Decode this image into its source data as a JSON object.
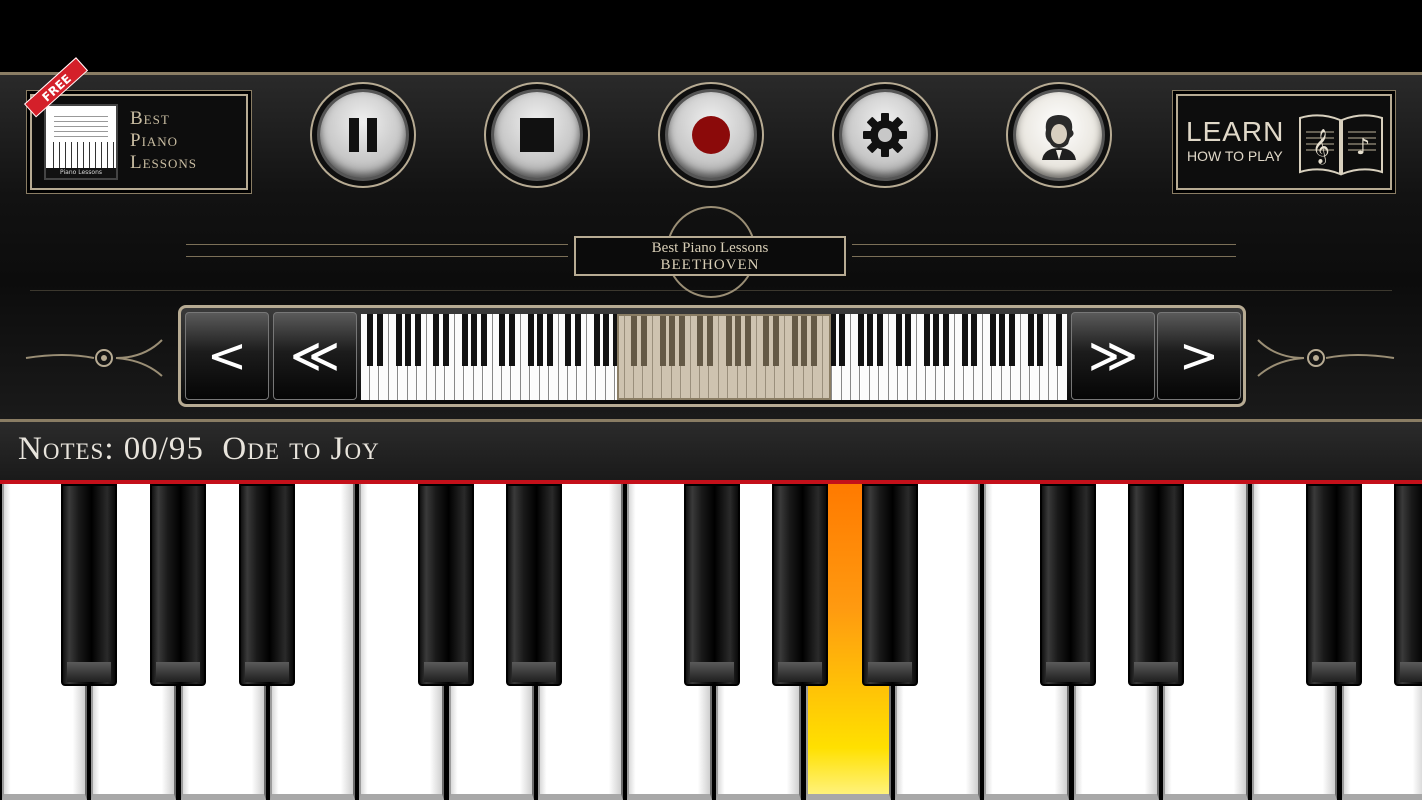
{
  "promo_left": {
    "ribbon": "FREE",
    "title_lines": [
      "Best",
      "Piano",
      "Lessons"
    ],
    "thumb_label": "Piano Lessons"
  },
  "controls": [
    {
      "name": "pause",
      "icon": "pause-icon"
    },
    {
      "name": "stop",
      "icon": "stop-icon"
    },
    {
      "name": "record",
      "icon": "record-icon"
    },
    {
      "name": "settings",
      "icon": "gear-icon"
    },
    {
      "name": "beethoven",
      "icon": "beethoven-portrait-icon"
    }
  ],
  "promo_right": {
    "big": "LEARN",
    "small": "HOW TO PLAY",
    "icon": "music-book-icon"
  },
  "emblem": {
    "line1": "Best Piano Lessons",
    "line2": "BEETHOVEN"
  },
  "scroller": {
    "prev": "<",
    "fast_prev": "≪",
    "fast_next": "≫",
    "next": ">"
  },
  "notes_bar": {
    "label": "Notes:",
    "count": "00/95",
    "song": "Ode to Joy"
  },
  "colors": {
    "gold_trim": "#b7ab93",
    "record_red": "#8b0a0a",
    "active_key_top": "#ff7a00",
    "active_key_bottom": "#ffe000",
    "red_divider": "#c4101a"
  },
  "keyboard": {
    "active_white_key_index": 9
  }
}
